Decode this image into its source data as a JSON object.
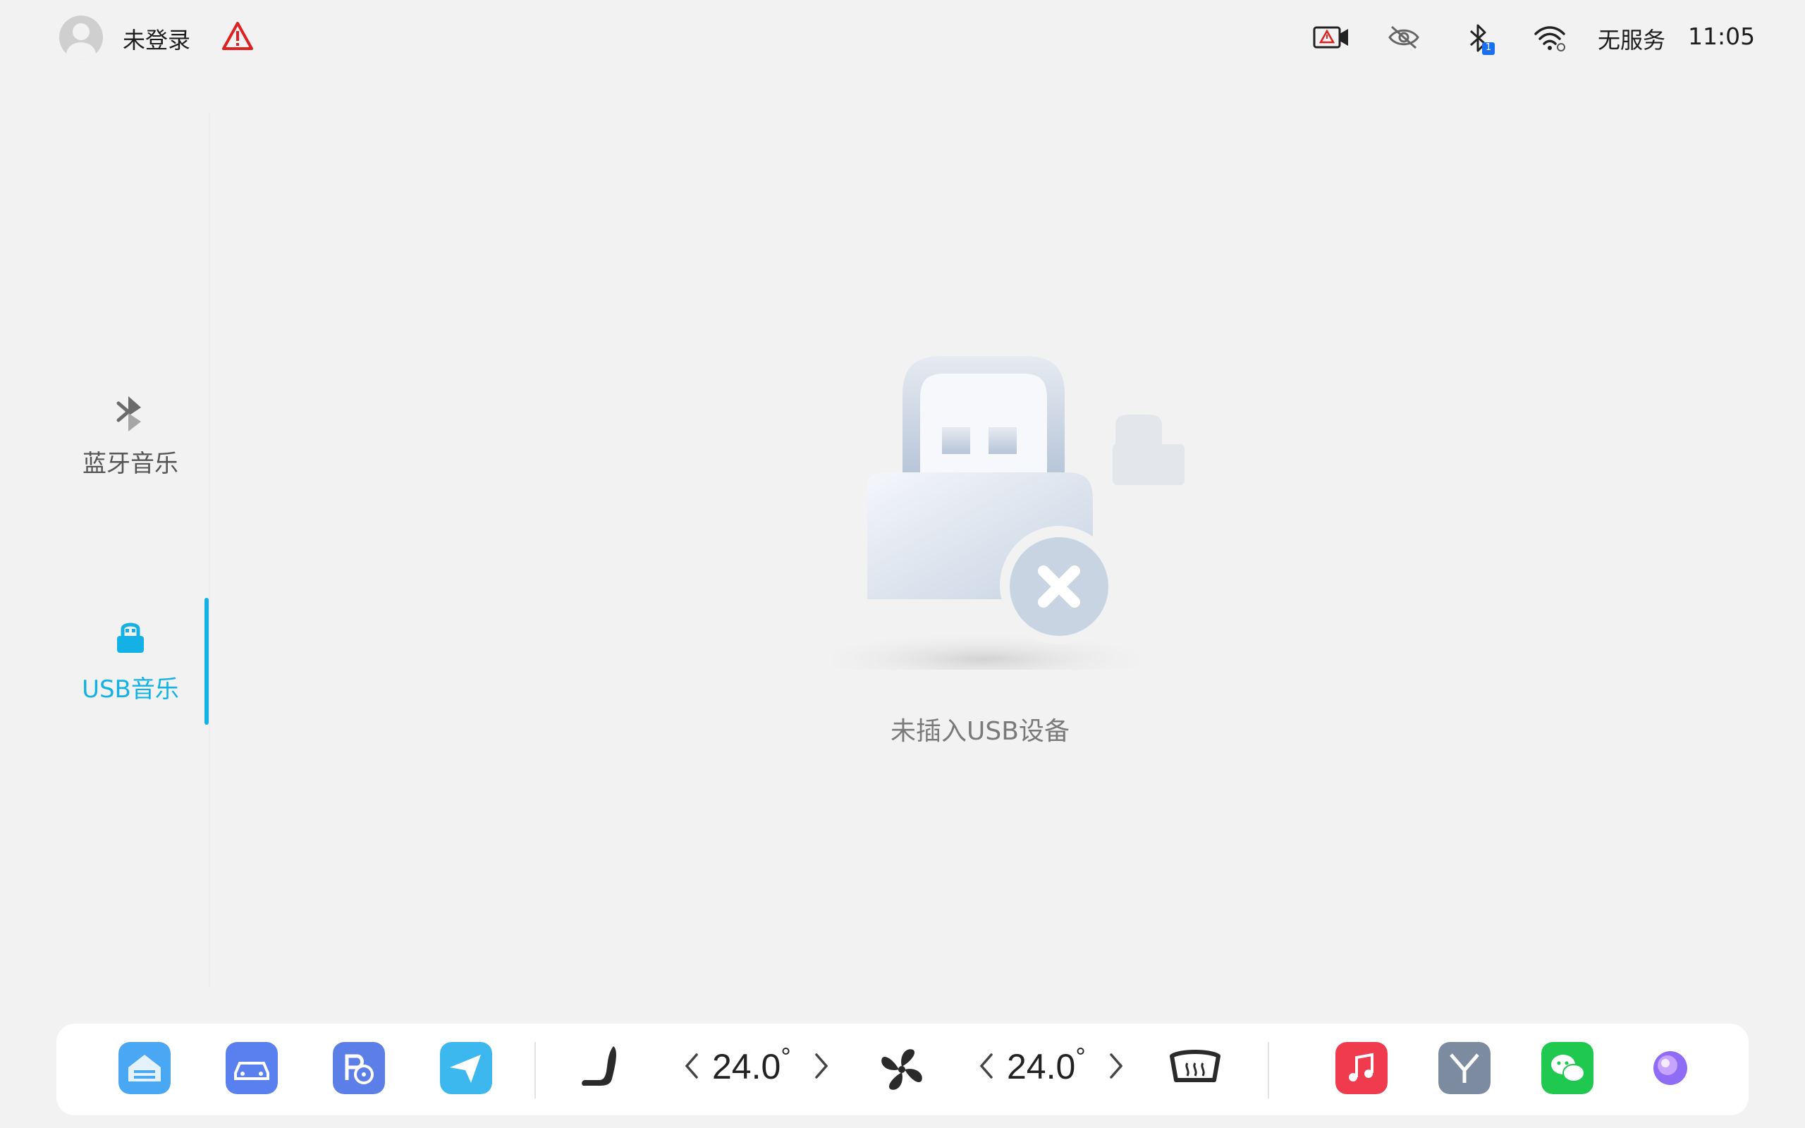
{
  "status_bar": {
    "login_label": "未登录",
    "service_label": "无服务",
    "time": "11:05",
    "bluetooth_badge": "1",
    "icons": [
      "avatar-icon",
      "warning-icon",
      "dashcam-icon",
      "eye-off-icon",
      "bluetooth-icon",
      "wifi-icon"
    ]
  },
  "sidebar": {
    "items": [
      {
        "label": "蓝牙音乐",
        "icon": "bluetooth-icon",
        "active": false
      },
      {
        "label": "USB音乐",
        "icon": "usb-icon",
        "active": true
      }
    ]
  },
  "main": {
    "empty_label": "未插入USB设备",
    "illustration": "usb-disconnected-icon"
  },
  "dock": {
    "apps_left": [
      "home-app-icon",
      "vehicle-app-icon",
      "parking-app-icon",
      "navigation-app-icon"
    ],
    "climate": {
      "left_temp": "24.0",
      "right_temp": "24.0",
      "unit": "°",
      "icons": [
        "seat-icon",
        "fan-icon",
        "rear-defrost-icon"
      ]
    },
    "apps_right": [
      "music-app-icon",
      "brand-app-icon",
      "wechat-app-icon",
      "assistant-app-icon"
    ]
  },
  "colors": {
    "accent": "#13b1e6",
    "background": "#f2f2f2",
    "warning": "#e02020",
    "dock_bg": "#ffffff"
  }
}
